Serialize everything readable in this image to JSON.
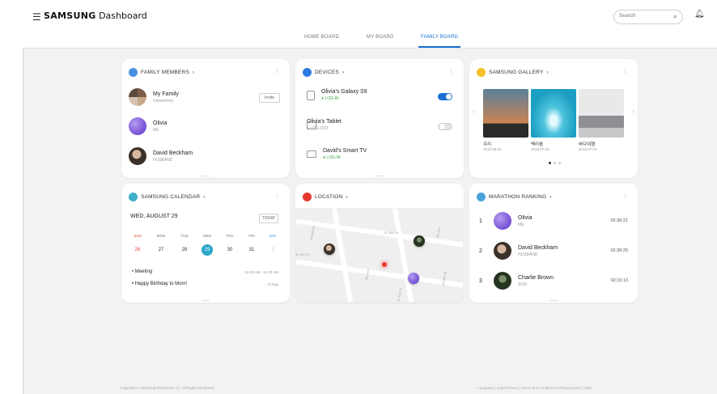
{
  "header": {
    "menu_icon": "hamburger-icon",
    "brand_bold": "SAMSUNG",
    "brand_rest": " Dashboard",
    "search_placeholder": "Search",
    "search_icon": "search-icon",
    "bell_icon": "bell-icon"
  },
  "tabs": [
    {
      "label": "HOME BOARD",
      "active": false
    },
    {
      "label": "MY BOARD",
      "active": false
    },
    {
      "label": "FAMILY BOARD",
      "active": true
    }
  ],
  "family": {
    "title": "FAMILY MEMBERS",
    "icon_color": "#4a90e2",
    "invite_label": "Invite",
    "members": [
      {
        "name": "My Family",
        "sub": "Owner(me)"
      },
      {
        "name": "Olivia",
        "sub": "ME"
      },
      {
        "name": "David Beckham",
        "sub": "HUSBAND"
      }
    ]
  },
  "devices": {
    "title": "DEVICES",
    "icon_color": "#2b7be0",
    "items": [
      {
        "name": "Olivia's Galaxy S9",
        "sub": "● LOG-IN",
        "on": true
      },
      {
        "name": "Olivia's Tablet",
        "sub": "● LOG-OUT",
        "on": false
      },
      {
        "name": "David's Smart TV",
        "sub": "● LOG-IN",
        "on": null
      }
    ]
  },
  "gallery": {
    "title": "SAMSUNG GALLERY",
    "icon_color": "#f5c12a",
    "photos": [
      {
        "title": "우리",
        "date": "2018.08.26"
      },
      {
        "title": "팩리움",
        "date": "2018.07.03"
      },
      {
        "title": "바다여행",
        "date": "2018.07.03"
      }
    ]
  },
  "calendar": {
    "title": "SAMSUNG CALENDAR",
    "icon_color": "#3fb0c8",
    "date_label": "WED, AUGUST 29",
    "today_label": "TODAY",
    "weekdays": [
      "SUN",
      "MON",
      "TUE",
      "WED",
      "THU",
      "FRI",
      "SAT"
    ],
    "days": [
      "26",
      "27",
      "28",
      "29",
      "30",
      "31",
      "1"
    ],
    "events": [
      {
        "title": "• Meeting",
        "time": "10:00 AM - 11:30 AM"
      },
      {
        "title": "• Happy Birthday to Mom!",
        "time": "All Day"
      }
    ]
  },
  "location": {
    "title": "LOCATION",
    "icon_color": "#e8392e",
    "street_labels": [
      "Broadway",
      "W 38th St",
      "5th Ave",
      "W 40th St",
      "8th Ave",
      "W 39th St",
      "W 41st St"
    ]
  },
  "marathon": {
    "title": "MARATHON RANKING",
    "icon_color": "#4aa3d9",
    "entries": [
      {
        "rank": "1",
        "name": "Olivia",
        "sub": "ME",
        "time": "02:39:21"
      },
      {
        "rank": "2",
        "name": "David Beckham",
        "sub": "HUSBAND",
        "time": "02:39:25"
      },
      {
        "rank": "3",
        "name": "Charlie Brown",
        "sub": "SON",
        "time": "02:15:13"
      }
    ]
  },
  "footer": {
    "copyright": "Copyright © Samsung Electronics Co. All Rights Reserved",
    "links": "Language  |  Legal Privacy  |  Terms and conditions  |  Privacy policy  |  Help"
  }
}
